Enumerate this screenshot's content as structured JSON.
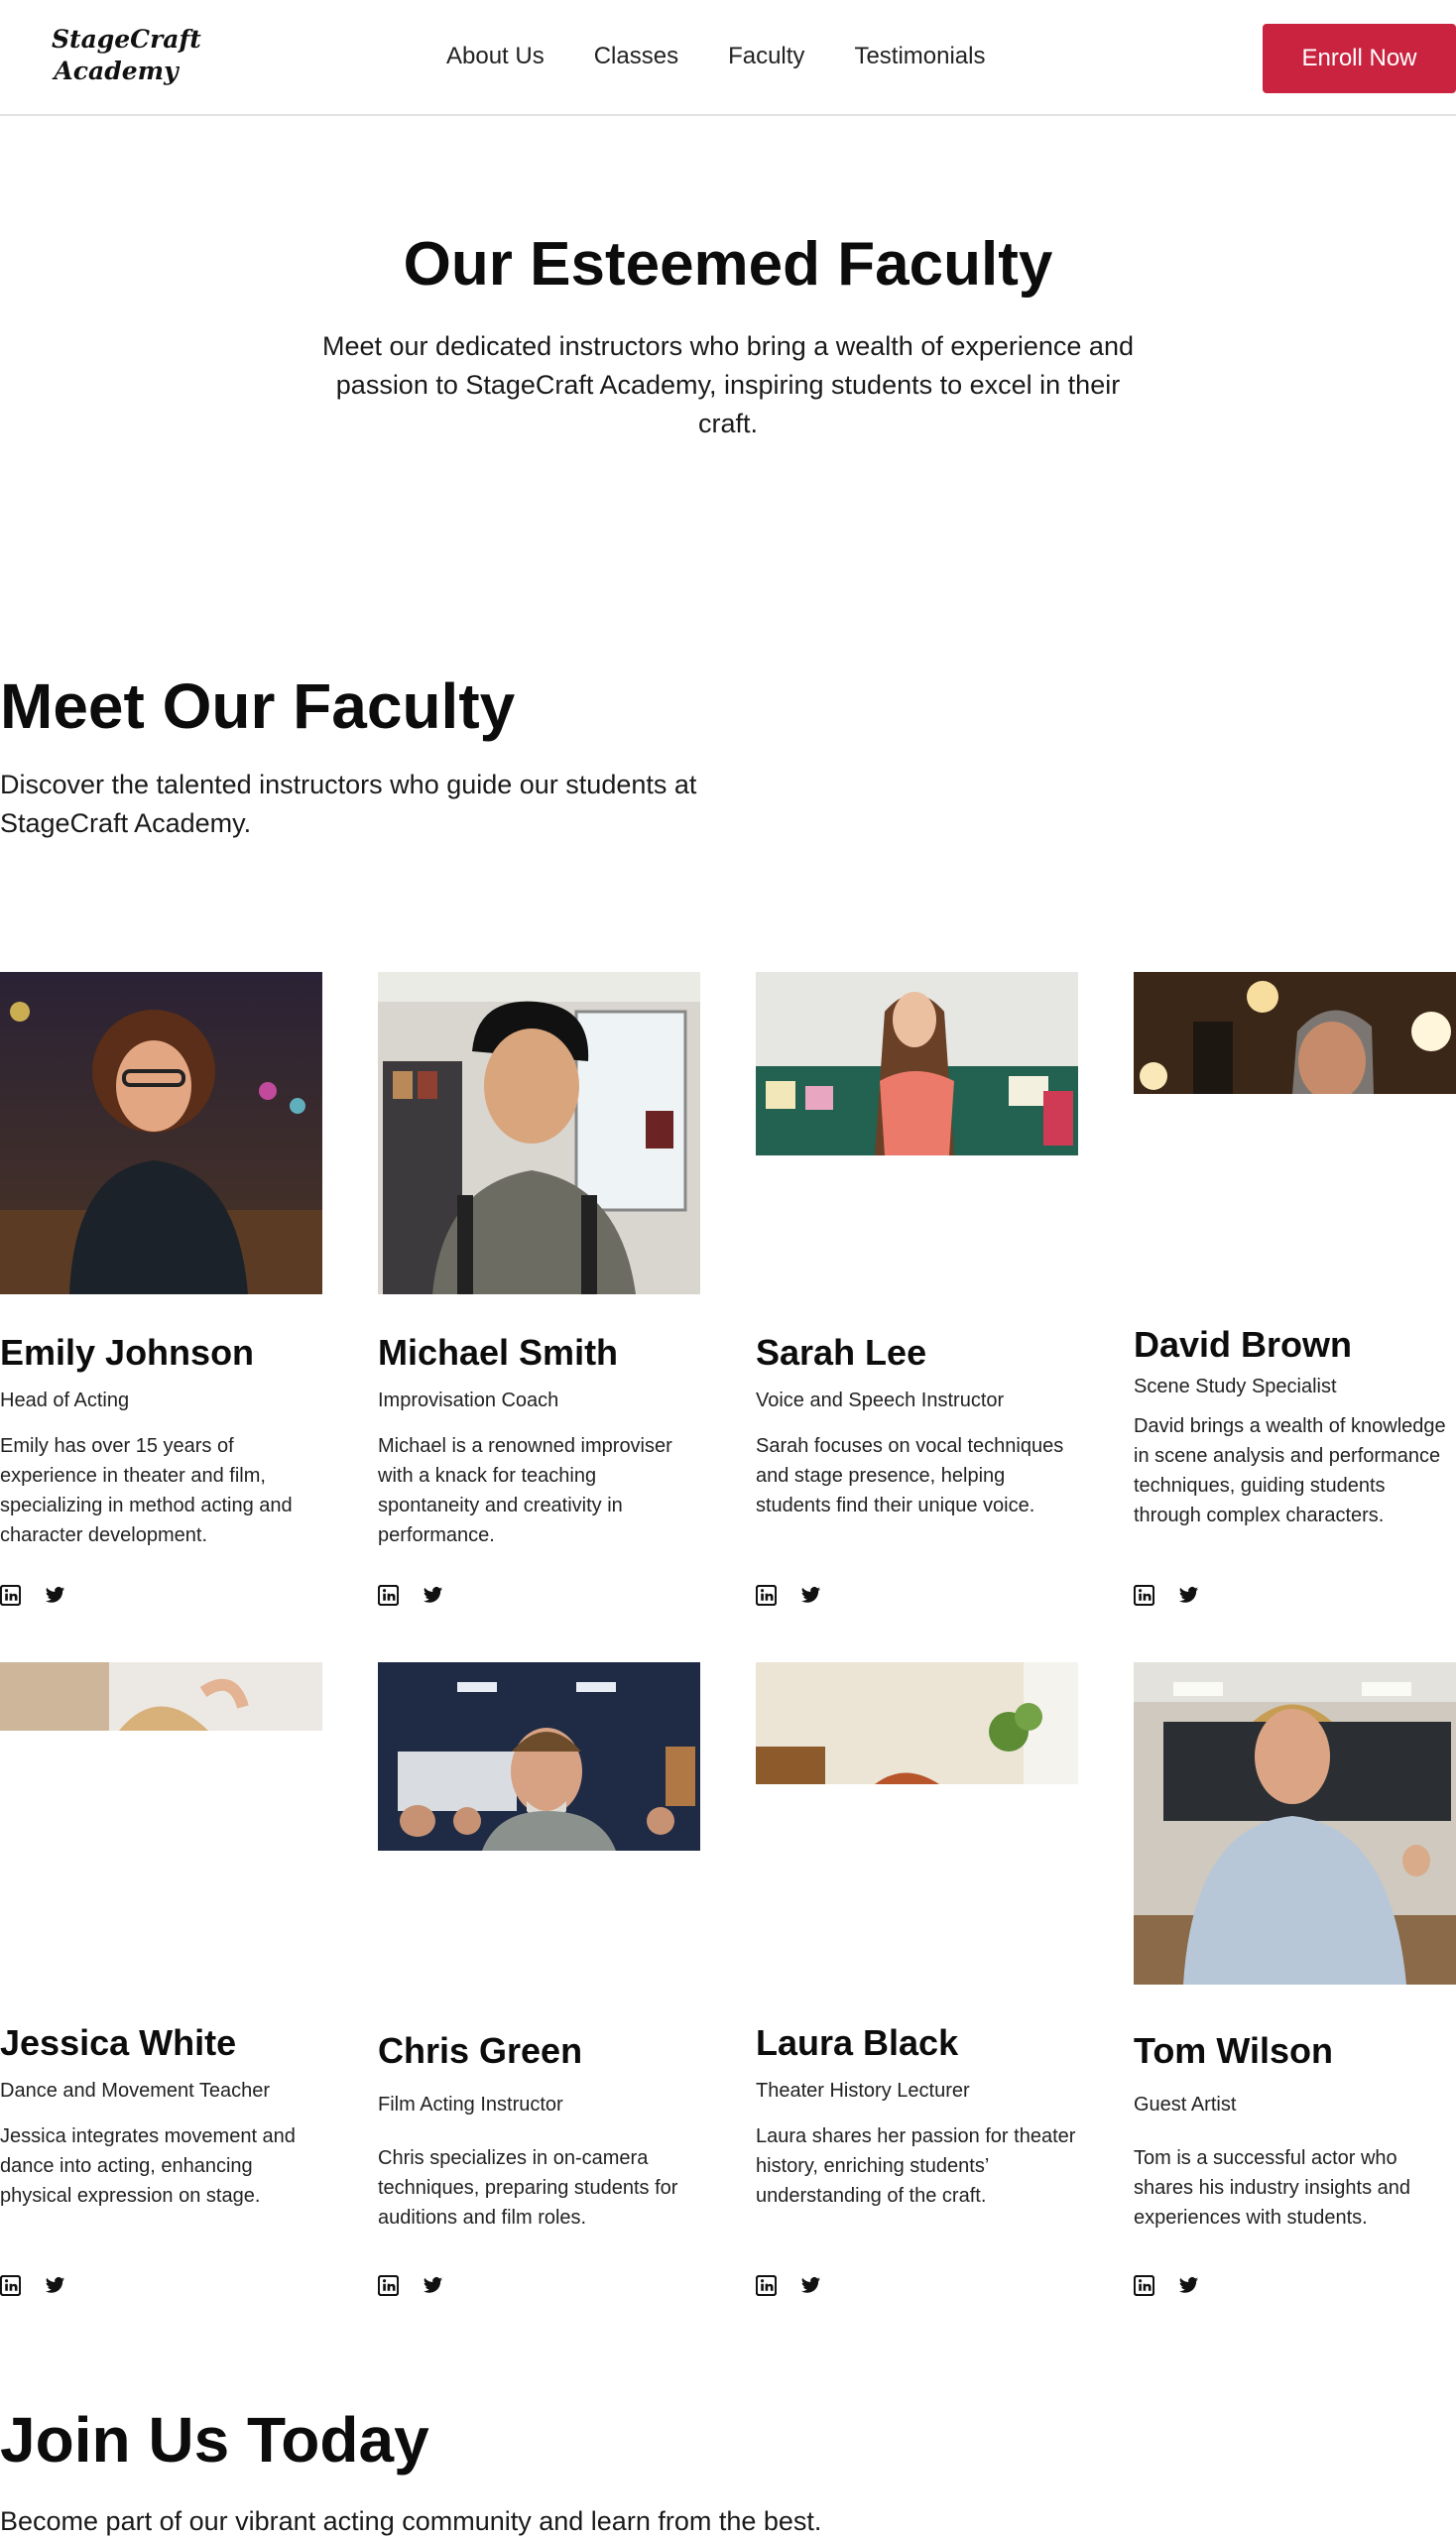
{
  "nav": {
    "logo_line1": "StageCraft",
    "logo_line2": "Academy",
    "links": [
      "About Us",
      "Classes",
      "Faculty",
      "Testimonials"
    ],
    "cta": "Enroll Now",
    "accent_color": "#c9233f"
  },
  "hero": {
    "title": "Our Esteemed Faculty",
    "subtitle": "Meet our dedicated instructors who bring a wealth of experience and passion to StageCraft Academy, inspiring students to excel in their craft."
  },
  "meet": {
    "title": "Meet Our Faculty",
    "subtitle": "Discover the talented instructors who guide our students at StageCraft Academy."
  },
  "faculty": [
    {
      "name": "Emily Johnson",
      "role": "Head of Acting",
      "bio": "Emily has over 15 years of experience in theater and film, specializing in method acting and character development.",
      "icons": [
        "linkedin-icon",
        "twitter-icon"
      ]
    },
    {
      "name": "Michael Smith",
      "role": "Improvisation Coach",
      "bio": "Michael is a renowned improviser with a knack for teaching spontaneity and creativity in performance.",
      "icons": [
        "linkedin-icon",
        "twitter-icon"
      ]
    },
    {
      "name": "Sarah Lee",
      "role": "Voice and Speech Instructor",
      "bio": "Sarah focuses on vocal techniques and stage presence, helping students find their unique voice.",
      "icons": [
        "linkedin-icon",
        "twitter-icon"
      ]
    },
    {
      "name": "David Brown",
      "role": "Scene Study Specialist",
      "bio": "David brings a wealth of knowledge in scene analysis and performance techniques, guiding students through complex characters.",
      "icons": [
        "linkedin-icon",
        "twitter-icon"
      ]
    },
    {
      "name": "Jessica White",
      "role": "Dance and Movement Teacher",
      "bio": "Jessica integrates movement and dance into acting, enhancing physical expression on stage.",
      "icons": [
        "linkedin-icon",
        "twitter-icon"
      ]
    },
    {
      "name": "Chris Green",
      "role": "Film Acting Instructor",
      "bio": "Chris specializes in on-camera techniques, preparing students for auditions and film roles.",
      "icons": [
        "linkedin-icon",
        "twitter-icon"
      ]
    },
    {
      "name": "Laura Black",
      "role": "Theater History Lecturer",
      "bio": "Laura shares her passion for theater history, enriching students’ understanding of the craft.",
      "icons": [
        "linkedin-icon",
        "twitter-icon"
      ]
    },
    {
      "name": "Tom Wilson",
      "role": "Guest Artist",
      "bio": "Tom is a successful actor who shares his industry insights and experiences with students.",
      "icons": [
        "linkedin-icon",
        "twitter-icon"
      ]
    }
  ],
  "join": {
    "title": "Join Us Today",
    "subtitle": "Become part of our vibrant acting community and learn from the best."
  }
}
